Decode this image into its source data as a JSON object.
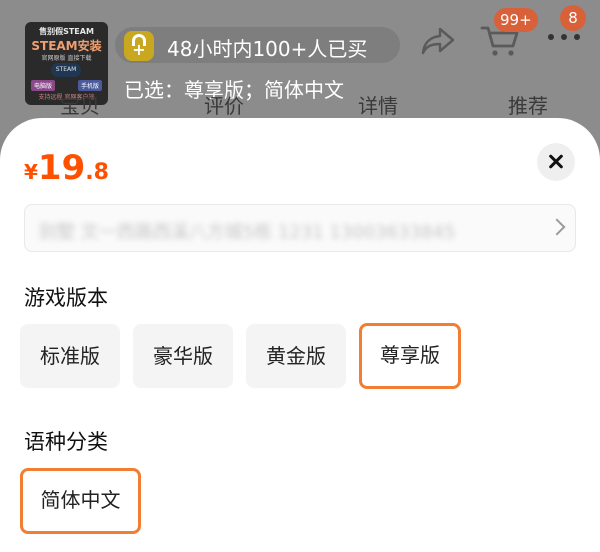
{
  "product_thumb": {
    "line1": "售别假STEAM",
    "line2": "STEAM安装",
    "line3": "官网原版 直接下载",
    "logo": "STEAM",
    "chip1": "电脑版",
    "chip2": "手机版",
    "line4": "支持远程 官网客户端"
  },
  "header": {
    "hot_text": "48小时内100+人已买",
    "selected_text": "已选：尊享版；简体中文",
    "cart_badge": "99+",
    "msg_badge": "8"
  },
  "bg_tabs": [
    {
      "label": "宝贝"
    },
    {
      "label": "评价"
    },
    {
      "label": "详情"
    },
    {
      "label": "推荐"
    }
  ],
  "sheet": {
    "price": {
      "currency": "¥",
      "integer": "19",
      "decimal": ".8"
    },
    "address_text": "别墅 文一西路西溪八方城5栋 1231 13003633845",
    "version_title": "游戏版本",
    "version_options": [
      {
        "label": "标准版",
        "selected": false
      },
      {
        "label": "豪华版",
        "selected": false
      },
      {
        "label": "黄金版",
        "selected": false
      },
      {
        "label": "尊享版",
        "selected": true
      }
    ],
    "lang_title": "语种分类",
    "lang_options": [
      {
        "label": "简体中文",
        "selected": true
      }
    ]
  },
  "colors": {
    "accent": "#ff5000",
    "selected_border": "#f27e34",
    "badge": "#d9613a"
  },
  "icons": [
    "lock-plus-icon",
    "share-icon",
    "cart-icon",
    "more-icon",
    "close-icon",
    "chevron-right-icon"
  ]
}
